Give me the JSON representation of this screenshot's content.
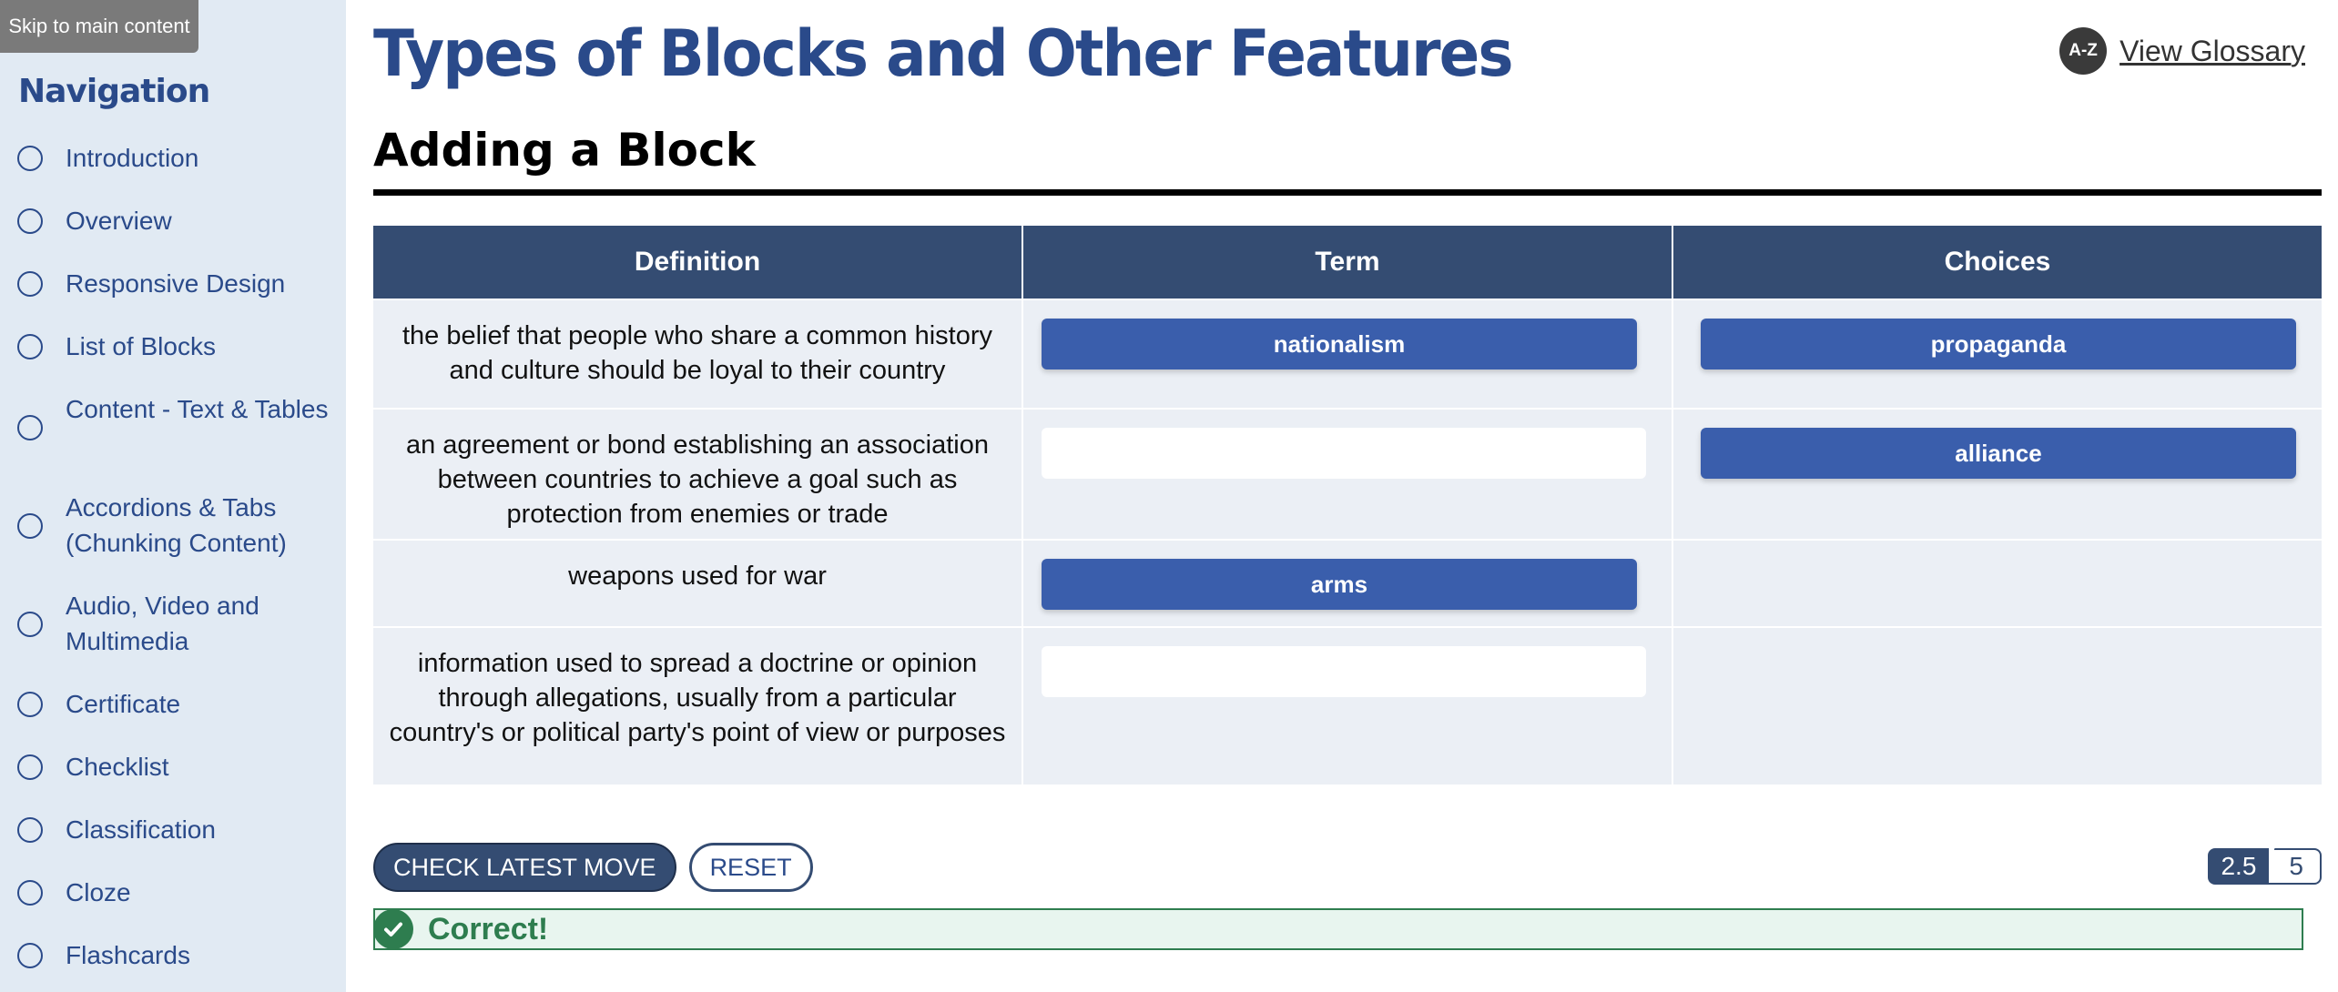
{
  "skip_link": "Skip to main content",
  "sidebar": {
    "title": "Navigation",
    "items": [
      {
        "label": "Introduction"
      },
      {
        "label": "Overview"
      },
      {
        "label": "Responsive Design"
      },
      {
        "label": "List of Blocks"
      },
      {
        "label": "Content - Text & Tables"
      },
      {
        "label": "Accordions & Tabs (Chunking Content)"
      },
      {
        "label": "Audio, Video and Multimedia"
      },
      {
        "label": "Certificate"
      },
      {
        "label": "Checklist"
      },
      {
        "label": "Classification"
      },
      {
        "label": "Cloze"
      },
      {
        "label": "Flashcards"
      }
    ]
  },
  "header": {
    "title": "Types of Blocks and Other Features",
    "glossary_icon": "A-Z",
    "glossary_label": "View Glossary"
  },
  "section": {
    "title": "Adding a Block"
  },
  "activity": {
    "columns": [
      "Definition",
      "Term",
      "Choices"
    ],
    "rows": [
      {
        "definition": "the belief that people who share a common history and culture should be loyal to their country",
        "term": "nationalism",
        "choice": "propaganda"
      },
      {
        "definition": "an agreement or bond establishing an association between countries to achieve a goal such as protection from enemies or trade",
        "term": "",
        "choice": "alliance"
      },
      {
        "definition": "weapons used for war",
        "term": "arms",
        "choice": ""
      },
      {
        "definition": "information used to spread a doctrine or opinion through allegations, usually from a particular country's or political party's point of view or purposes",
        "term": "",
        "choice": ""
      }
    ]
  },
  "controls": {
    "check_label": "CHECK LATEST MOVE",
    "reset_label": "RESET"
  },
  "score": {
    "earned": "2.5",
    "total": "5"
  },
  "feedback": {
    "text": "Correct!"
  },
  "colors": {
    "brand_blue": "#2a4a8a",
    "header_navy": "#344c72",
    "chip_blue": "#3a5eac",
    "success_green": "#2e7d4f"
  }
}
